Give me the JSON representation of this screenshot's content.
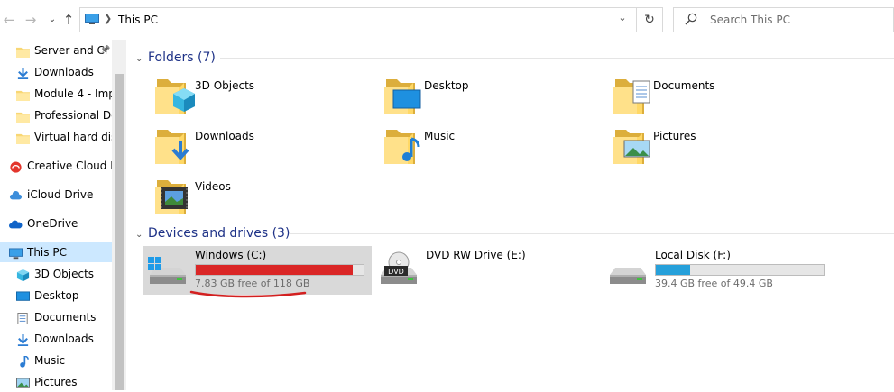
{
  "address_bar": {
    "path": "This PC",
    "back_icon": "back-arrow-icon",
    "forward_icon": "forward-arrow-icon",
    "recent_icon": "chevron-down-icon",
    "up_icon": "up-arrow-icon",
    "refresh_icon": "refresh-icon"
  },
  "search": {
    "placeholder": "Search This PC"
  },
  "sidebar": {
    "items": [
      {
        "label": "Server and Cl",
        "icon": "folder-icon",
        "pinned": true
      },
      {
        "label": "Downloads",
        "icon": "download-arrow-icon"
      },
      {
        "label": "Module 4 - Impl",
        "icon": "folder-icon"
      },
      {
        "label": "Professional Dev",
        "icon": "folder-icon"
      },
      {
        "label": "Virtual hard disk",
        "icon": "folder-icon"
      },
      {
        "label": "Creative Cloud Fil",
        "icon": "creative-cloud-icon"
      },
      {
        "label": "iCloud Drive",
        "icon": "icloud-icon"
      },
      {
        "label": "OneDrive",
        "icon": "onedrive-icon"
      },
      {
        "label": "This PC",
        "icon": "computer-icon",
        "selected": true
      },
      {
        "label": "3D Objects",
        "icon": "cube-icon"
      },
      {
        "label": "Desktop",
        "icon": "desktop-icon"
      },
      {
        "label": "Documents",
        "icon": "documents-icon"
      },
      {
        "label": "Downloads",
        "icon": "download-arrow-icon"
      },
      {
        "label": "Music",
        "icon": "music-note-icon"
      },
      {
        "label": "Pictures",
        "icon": "pictures-icon"
      }
    ]
  },
  "folders": {
    "heading": "Folders (7)",
    "items": [
      {
        "name": "3D Objects",
        "icon": "3d-objects-folder-icon"
      },
      {
        "name": "Desktop",
        "icon": "desktop-folder-icon"
      },
      {
        "name": "Documents",
        "icon": "documents-folder-icon"
      },
      {
        "name": "Downloads",
        "icon": "downloads-folder-icon"
      },
      {
        "name": "Music",
        "icon": "music-folder-icon"
      },
      {
        "name": "Pictures",
        "icon": "pictures-folder-icon"
      },
      {
        "name": "Videos",
        "icon": "videos-folder-icon"
      }
    ]
  },
  "devices": {
    "heading": "Devices and drives (3)",
    "items": [
      {
        "name": "Windows (C:)",
        "free_text": "7.83 GB free of 118 GB",
        "used_fraction": 0.934,
        "bar_color": "#da2626",
        "selected": true
      },
      {
        "name": "DVD RW Drive (E:)",
        "has_bar": false
      },
      {
        "name": "Local Disk (F:)",
        "free_text": "39.4 GB free of 49.4 GB",
        "used_fraction": 0.202,
        "bar_color": "#26a0da"
      }
    ]
  },
  "colors": {
    "selection_bg": "#cce8ff",
    "drive_selected_bg": "#d9d9d9",
    "group_heading": "#1e3287",
    "annotation_underline": "#d32020"
  }
}
